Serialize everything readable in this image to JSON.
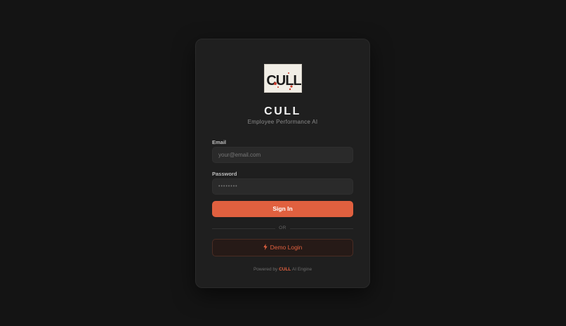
{
  "brand": {
    "logo_text": "CULL",
    "title": "CULL",
    "subtitle": "Employee Performance AI"
  },
  "form": {
    "email_label": "Email",
    "email_placeholder": "your@email.com",
    "password_label": "Password",
    "password_placeholder": "••••••••",
    "signin_label": "Sign In",
    "divider_text": "OR",
    "demo_label": "Demo Login"
  },
  "footer": {
    "prefix": "Powered by",
    "brand": "CULL",
    "suffix": "AI Engine"
  },
  "colors": {
    "accent": "#e0603f",
    "background": "#141414",
    "card": "#1f1f1f"
  }
}
